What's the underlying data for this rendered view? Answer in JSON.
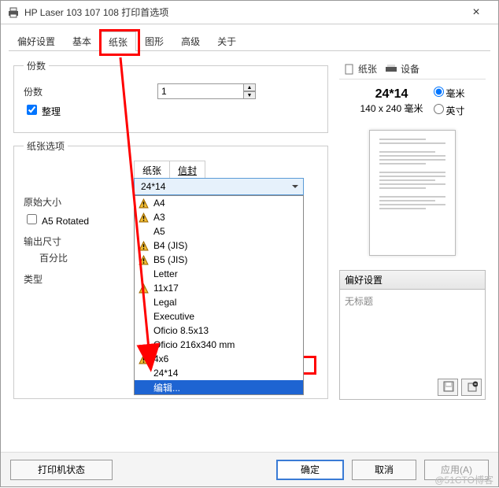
{
  "window": {
    "title": "HP Laser 103 107 108 打印首选项"
  },
  "tabs": [
    "偏好设置",
    "基本",
    "纸张",
    "图形",
    "高级",
    "关于"
  ],
  "copies": {
    "legend": "份数",
    "count_label": "份数",
    "count_value": "1",
    "collate_label": "整理"
  },
  "paper": {
    "legend": "纸张选项",
    "sub_paper": "纸张",
    "sub_envelope": "信封",
    "dd_selected": "24*14",
    "items": [
      {
        "t": "A4",
        "w": true
      },
      {
        "t": "A3",
        "w": true
      },
      {
        "t": "A5",
        "w": false
      },
      {
        "t": "B4 (JIS)",
        "w": true
      },
      {
        "t": "B5 (JIS)",
        "w": true
      },
      {
        "t": "Letter",
        "w": false
      },
      {
        "t": "11x17",
        "w": true
      },
      {
        "t": "Legal",
        "w": false
      },
      {
        "t": "Executive",
        "w": false
      },
      {
        "t": "Oficio 8.5x13",
        "w": false
      },
      {
        "t": "Oficio 216x340 mm",
        "w": false
      },
      {
        "t": "4x6",
        "w": true
      },
      {
        "t": "24*14",
        "w": false
      },
      {
        "t": "编辑...",
        "w": false,
        "hl": true
      }
    ],
    "orig_label": "原始大小",
    "a5rot_label": "A5 Rotated",
    "outsize_label": "输出尺寸",
    "percent_label": "百分比",
    "type_label": "类型"
  },
  "right": {
    "tab_paper": "纸张",
    "tab_device": "设备",
    "dim_big": "24*14",
    "dim_small": "140 x 240 毫米",
    "unit_mm": "毫米",
    "unit_in": "英寸",
    "pref_header": "偏好设置",
    "pref_placeholder": "无标题"
  },
  "footer": {
    "status": "打印机状态",
    "ok": "确定",
    "cancel": "取消",
    "apply": "应用(A)"
  },
  "watermark": "@51CTO博客"
}
